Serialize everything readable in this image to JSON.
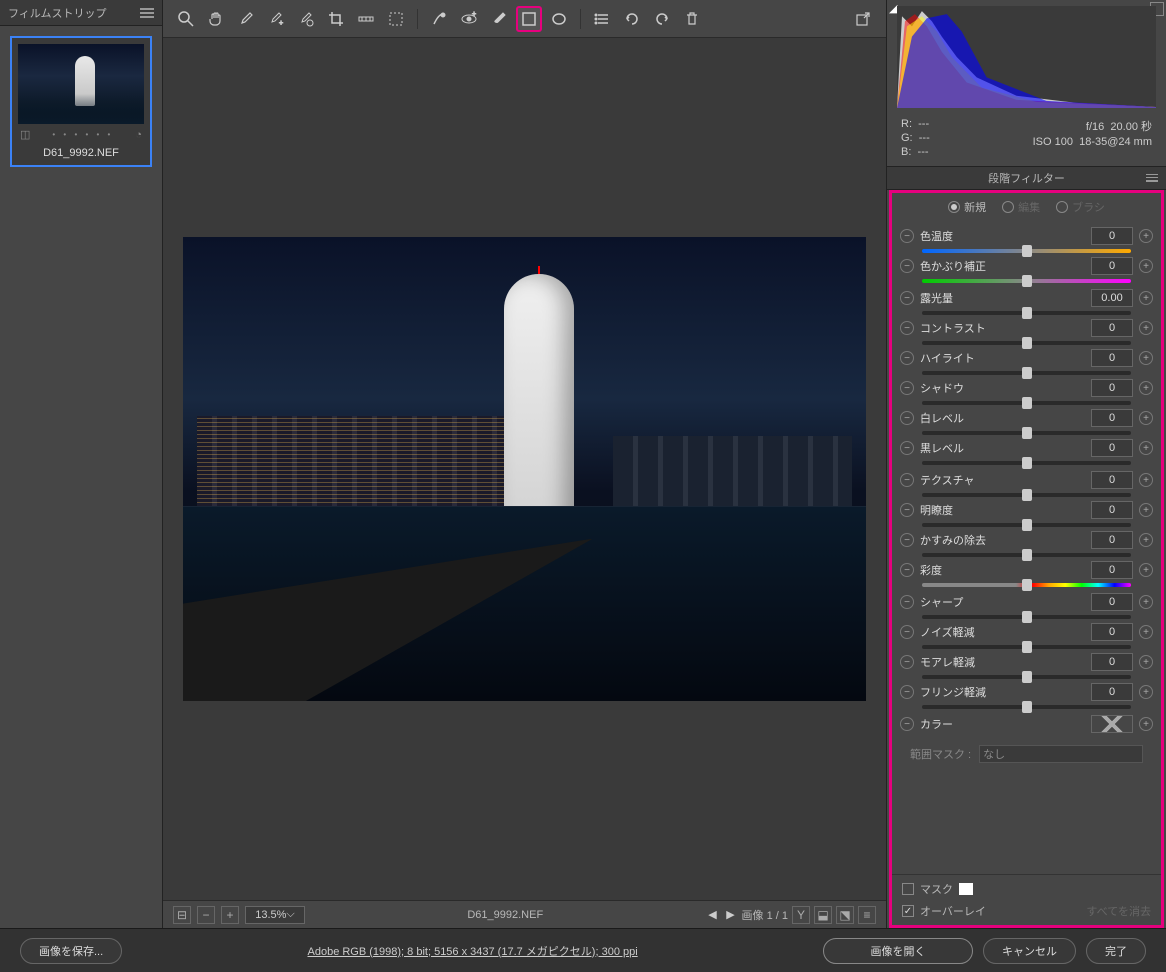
{
  "filmstrip": {
    "title": "フィルムストリップ",
    "thumb_name": "D61_9992.NEF"
  },
  "toolbar_icons": [
    "zoom-icon",
    "hand-icon",
    "eyedropper-white-icon",
    "eyedropper-plus-icon",
    "eyedropper-target-icon",
    "crop-icon",
    "straighten-icon",
    "transform-icon",
    "spot-heal-icon",
    "redeye-icon",
    "brush-icon",
    "graduated-filter-icon",
    "radial-filter-icon",
    "list-icon",
    "rotate-ccw-icon",
    "rotate-cw-icon",
    "trash-icon"
  ],
  "status": {
    "zoom": "13.5%",
    "filename": "D61_9992.NEF",
    "page": "画像 1 / 1"
  },
  "exif": {
    "r": "R:",
    "r_val": "---",
    "g": "G:",
    "g_val": "---",
    "b": "B:",
    "b_val": "---",
    "aperture": "f/16",
    "shutter": "20.00 秒",
    "iso": "ISO 100",
    "lens": "18-35@24 mm"
  },
  "panel_title": "段階フィルター",
  "modes": {
    "new": "新規",
    "edit": "編集",
    "brush": "ブラシ"
  },
  "sliders": {
    "group1": [
      {
        "label": "色温度",
        "val": "0",
        "grad": "temp"
      },
      {
        "label": "色かぶり補正",
        "val": "0",
        "grad": "tint"
      }
    ],
    "group2": [
      {
        "label": "露光量",
        "val": "0.00"
      },
      {
        "label": "コントラスト",
        "val": "0"
      },
      {
        "label": "ハイライト",
        "val": "0"
      },
      {
        "label": "シャドウ",
        "val": "0"
      },
      {
        "label": "白レベル",
        "val": "0"
      },
      {
        "label": "黒レベル",
        "val": "0"
      }
    ],
    "group3": [
      {
        "label": "テクスチャ",
        "val": "0"
      },
      {
        "label": "明瞭度",
        "val": "0"
      },
      {
        "label": "かすみの除去",
        "val": "0"
      },
      {
        "label": "彩度",
        "val": "0",
        "grad": "sat"
      }
    ],
    "group4": [
      {
        "label": "シャープ",
        "val": "0"
      },
      {
        "label": "ノイズ軽減",
        "val": "0"
      },
      {
        "label": "モアレ軽減",
        "val": "0"
      },
      {
        "label": "フリンジ軽減",
        "val": "0"
      }
    ]
  },
  "color_label": "カラー",
  "range_mask_label": "範囲マスク :",
  "range_mask_val": "なし",
  "mask_label": "マスク",
  "overlay_label": "オーバーレイ",
  "clear_all": "すべてを消去",
  "bottom": {
    "save": "画像を保存...",
    "info": "Adobe RGB (1998); 8 bit; 5156 x 3437 (17.7 メガピクセル); 300 ppi",
    "open": "画像を開く",
    "cancel": "キャンセル",
    "done": "完了"
  }
}
